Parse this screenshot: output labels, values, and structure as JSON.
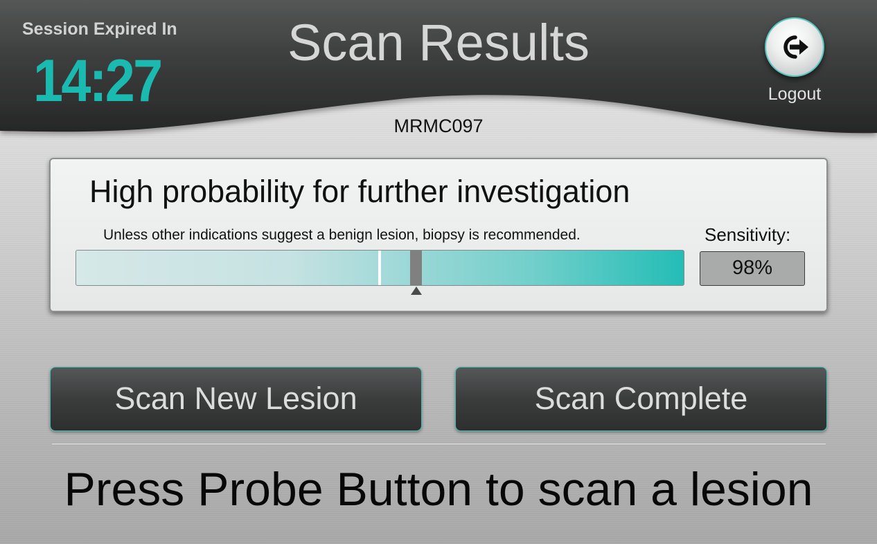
{
  "header": {
    "session_label": "Session Expired In",
    "session_timer": "14:27",
    "title": "Scan Results",
    "logout_label": "Logout",
    "logout_icon": "logout-arrow-icon"
  },
  "patient": {
    "id": "MRMC097"
  },
  "result": {
    "heading": "High probability for further investigation",
    "subtext": "Unless other indications suggest a benign lesion, biopsy is recommended.",
    "sensitivity_label": "Sensitivity:",
    "sensitivity_value": "98%",
    "score_fraction": 0.56,
    "threshold_fraction": 0.5
  },
  "actions": {
    "scan_new_label": "Scan New Lesion",
    "scan_complete_label": "Scan Complete"
  },
  "instruction": "Press Probe Button to scan a lesion",
  "colors": {
    "accent_teal": "#1bbab0",
    "header_dark": "#2f3030",
    "button_dark": "#3b3d3d"
  }
}
